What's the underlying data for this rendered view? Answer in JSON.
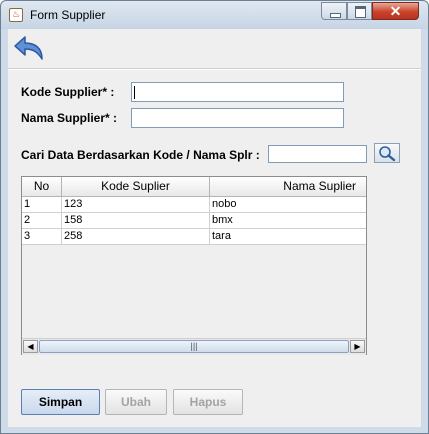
{
  "window": {
    "title": "Form Supplier",
    "close_glyph": "✕"
  },
  "icons": {
    "app": "java-cup-icon",
    "back": "back-arrow-icon",
    "search": "magnifier-icon"
  },
  "form": {
    "kode_label": "Kode Supplier*  :",
    "kode_value": "",
    "nama_label": "Nama Supplier* :",
    "nama_value": "",
    "search_label": "Cari Data Berdasarkan Kode / Nama Splr :",
    "search_value": ""
  },
  "table": {
    "columns": [
      "No",
      "Kode Suplier",
      "Nama Suplier"
    ],
    "rows": [
      [
        "1",
        "123",
        "nobo"
      ],
      [
        "2",
        "158",
        "bmx"
      ],
      [
        "3",
        "258",
        "tara"
      ]
    ]
  },
  "scrollbar": {
    "left_arrow": "◀",
    "right_arrow": "▶",
    "grip": "|||"
  },
  "buttons": {
    "save": "Simpan",
    "edit": "Ubah",
    "delete": "Hapus"
  },
  "colors": {
    "accent": "#5a7fb0",
    "close": "#c9432c"
  }
}
